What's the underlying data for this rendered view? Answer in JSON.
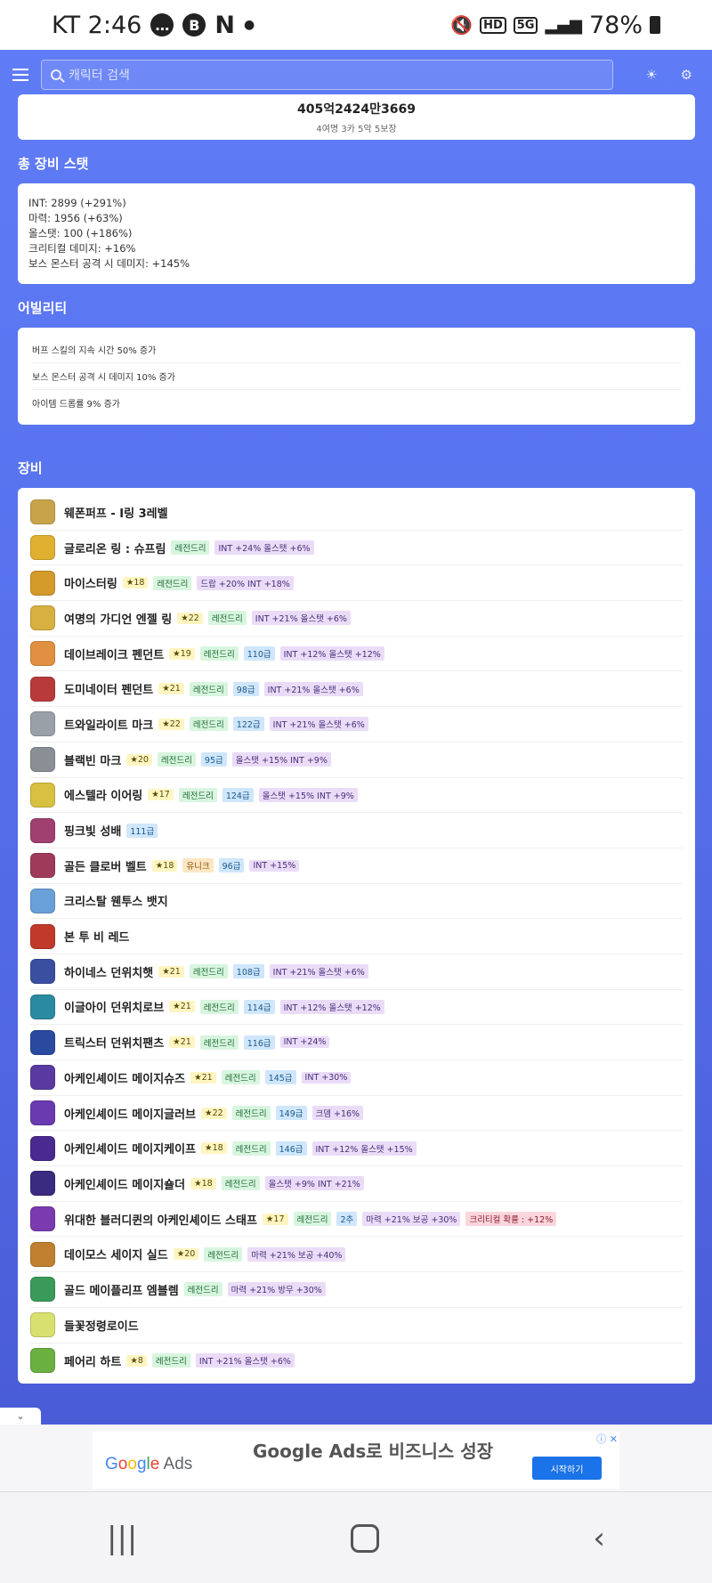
{
  "status_bar": {
    "carrier_time": "KT 2:46",
    "battery": "78%",
    "hd_label": "HD",
    "network_label": "5G"
  },
  "topbar": {
    "search_placeholder": "캐릭터 검색"
  },
  "combat": {
    "value": "405억2424만3669",
    "detail": "4여명 3카 5악 5보장"
  },
  "stats": {
    "title": "총 장비 스탯",
    "lines": [
      "INT: 2899 (+291%)",
      "마력: 1956 (+63%)",
      "올스탯: 100 (+186%)",
      "크리티컬 데미지: +16%",
      "보스 몬스터 공격 시 데미지: +145%"
    ]
  },
  "abilities": {
    "title": "어빌리티",
    "items": [
      "버프 스킬의 지속 시간 50% 증가",
      "보스 몬스터 공격 시 데미지 10% 증가",
      "아이템 드롭률 9% 증가"
    ]
  },
  "equipment": {
    "title": "장비",
    "items": [
      {
        "name": "웨폰퍼프 - I링 3레벨",
        "icon": "ring-icon",
        "color": "#c9a34a",
        "tags": []
      },
      {
        "name": "글로리온 링 : 슈프림",
        "icon": "ring-icon",
        "color": "#e0b030",
        "tags": [
          {
            "t": "leg",
            "v": "레전드리"
          },
          {
            "t": "pot",
            "v": "INT +24% 올스탯 +6%"
          }
        ]
      },
      {
        "name": "마이스터링",
        "icon": "ring-icon",
        "color": "#d49a2a",
        "tags": [
          {
            "t": "star",
            "v": "★18"
          },
          {
            "t": "leg",
            "v": "레전드리"
          },
          {
            "t": "pot",
            "v": "드랍 +20% INT +18%"
          }
        ]
      },
      {
        "name": "여명의 가디언 엔젤 링",
        "icon": "ring-icon",
        "color": "#d8b040",
        "tags": [
          {
            "t": "star",
            "v": "★22"
          },
          {
            "t": "leg",
            "v": "레전드리"
          },
          {
            "t": "pot",
            "v": "INT +21% 올스탯 +6%"
          }
        ]
      },
      {
        "name": "데이브레이크 펜던트",
        "icon": "pendant-icon",
        "color": "#e09040",
        "tags": [
          {
            "t": "star",
            "v": "★19"
          },
          {
            "t": "leg",
            "v": "레전드리"
          },
          {
            "t": "grade",
            "v": "110급"
          },
          {
            "t": "pot",
            "v": "INT +12% 올스탯 +12%"
          }
        ]
      },
      {
        "name": "도미네이터 펜던트",
        "icon": "pendant-icon",
        "color": "#b83a3a",
        "tags": [
          {
            "t": "star",
            "v": "★21"
          },
          {
            "t": "leg",
            "v": "레전드리"
          },
          {
            "t": "grade",
            "v": "98급"
          },
          {
            "t": "pot",
            "v": "INT +21% 올스탯 +6%"
          }
        ]
      },
      {
        "name": "트와일라이트 마크",
        "icon": "mark-icon",
        "color": "#9aa0a8",
        "tags": [
          {
            "t": "star",
            "v": "★22"
          },
          {
            "t": "leg",
            "v": "레전드리"
          },
          {
            "t": "grade",
            "v": "122급"
          },
          {
            "t": "pot",
            "v": "INT +21% 올스탯 +6%"
          }
        ]
      },
      {
        "name": "블랙빈 마크",
        "icon": "mark-icon",
        "color": "#8a8f96",
        "tags": [
          {
            "t": "star",
            "v": "★20"
          },
          {
            "t": "leg",
            "v": "레전드리"
          },
          {
            "t": "grade",
            "v": "95급"
          },
          {
            "t": "pot",
            "v": "올스탯 +15% INT +9%"
          }
        ]
      },
      {
        "name": "에스텔라 이어링",
        "icon": "earring-icon",
        "color": "#d8c040",
        "tags": [
          {
            "t": "star",
            "v": "★17"
          },
          {
            "t": "leg",
            "v": "레전드리"
          },
          {
            "t": "grade",
            "v": "124급"
          },
          {
            "t": "pot",
            "v": "올스탯 +15% INT +9%"
          }
        ]
      },
      {
        "name": "핑크빛 성배",
        "icon": "chalice-icon",
        "color": "#a04070",
        "tags": [
          {
            "t": "grade",
            "v": "111급"
          }
        ]
      },
      {
        "name": "골든 클로버 벨트",
        "icon": "belt-icon",
        "color": "#a03a5a",
        "tags": [
          {
            "t": "star",
            "v": "★18"
          },
          {
            "t": "uni",
            "v": "유니크"
          },
          {
            "t": "grade",
            "v": "96급"
          },
          {
            "t": "pot",
            "v": "INT +15%"
          }
        ]
      },
      {
        "name": "크리스탈 웬투스 뱃지",
        "icon": "badge-icon",
        "color": "#6aa0d8",
        "tags": []
      },
      {
        "name": "본 투 비 레드",
        "icon": "medal-icon",
        "color": "#c0392b",
        "tags": []
      },
      {
        "name": "하이네스 던위치햇",
        "icon": "hat-icon",
        "color": "#3a4fa0",
        "tags": [
          {
            "t": "star",
            "v": "★21"
          },
          {
            "t": "leg",
            "v": "레전드리"
          },
          {
            "t": "grade",
            "v": "108급"
          },
          {
            "t": "pot",
            "v": "INT +21% 올스탯 +6%"
          }
        ]
      },
      {
        "name": "이글아이 던위치로브",
        "icon": "robe-icon",
        "color": "#2a8aa0",
        "tags": [
          {
            "t": "star",
            "v": "★21"
          },
          {
            "t": "leg",
            "v": "레전드리"
          },
          {
            "t": "grade",
            "v": "114급"
          },
          {
            "t": "pot",
            "v": "INT +12% 올스탯 +12%"
          }
        ]
      },
      {
        "name": "트릭스터 던위치팬츠",
        "icon": "pants-icon",
        "color": "#2a4aa0",
        "tags": [
          {
            "t": "star",
            "v": "★21"
          },
          {
            "t": "leg",
            "v": "레전드리"
          },
          {
            "t": "grade",
            "v": "116급"
          },
          {
            "t": "pot",
            "v": "INT +24%"
          }
        ]
      },
      {
        "name": "아케인셰이드 메이지슈즈",
        "icon": "shoes-icon",
        "color": "#5a3aa0",
        "tags": [
          {
            "t": "star",
            "v": "★21"
          },
          {
            "t": "leg",
            "v": "레전드리"
          },
          {
            "t": "grade",
            "v": "145급"
          },
          {
            "t": "pot",
            "v": "INT +30%"
          }
        ]
      },
      {
        "name": "아케인셰이드 메이지글러브",
        "icon": "glove-icon",
        "color": "#6a3ab0",
        "tags": [
          {
            "t": "star",
            "v": "★22"
          },
          {
            "t": "leg",
            "v": "레전드리"
          },
          {
            "t": "grade",
            "v": "149급"
          },
          {
            "t": "pot",
            "v": "크뎀 +16%"
          }
        ]
      },
      {
        "name": "아케인셰이드 메이지케이프",
        "icon": "cape-icon",
        "color": "#4a2a90",
        "tags": [
          {
            "t": "star",
            "v": "★18"
          },
          {
            "t": "leg",
            "v": "레전드리"
          },
          {
            "t": "grade",
            "v": "146급"
          },
          {
            "t": "pot",
            "v": "INT +12% 올스탯 +15%"
          }
        ]
      },
      {
        "name": "아케인셰이드 메이지숄더",
        "icon": "shoulder-icon",
        "color": "#3a2a80",
        "tags": [
          {
            "t": "star",
            "v": "★18"
          },
          {
            "t": "leg",
            "v": "레전드리"
          },
          {
            "t": "pot",
            "v": "올스탯 +9% INT +21%"
          }
        ]
      },
      {
        "name": "위대한 블러디퀸의 아케인셰이드 스태프",
        "icon": "staff-icon",
        "color": "#7a3ab0",
        "tags": [
          {
            "t": "star",
            "v": "★17"
          },
          {
            "t": "leg",
            "v": "레전드리"
          },
          {
            "t": "grade",
            "v": "2추"
          },
          {
            "t": "pot",
            "v": "마력 +21% 보공 +30%"
          },
          {
            "t": "crit",
            "v": "크리티컬 확률 : +12%"
          }
        ]
      },
      {
        "name": "데이모스 세이지 실드",
        "icon": "shield-icon",
        "color": "#c08030",
        "tags": [
          {
            "t": "star",
            "v": "★20"
          },
          {
            "t": "leg",
            "v": "레전드리"
          },
          {
            "t": "pot",
            "v": "마력 +21% 보공 +40%"
          }
        ]
      },
      {
        "name": "골드 메이플리프 엠블렘",
        "icon": "emblem-icon",
        "color": "#3a9a5a",
        "tags": [
          {
            "t": "leg",
            "v": "레전드리"
          },
          {
            "t": "pot",
            "v": "마력 +21% 방무 +30%"
          }
        ]
      },
      {
        "name": "들꽃정령로이드",
        "icon": "android-icon",
        "color": "#d8e070",
        "tags": []
      },
      {
        "name": "페어리 하트",
        "icon": "heart-icon",
        "color": "#6ab040",
        "tags": [
          {
            "t": "star",
            "v": "★8"
          },
          {
            "t": "leg",
            "v": "레전드리"
          },
          {
            "t": "pot",
            "v": "INT +21% 올스탯 +6%"
          }
        ]
      }
    ]
  },
  "ad": {
    "logo": "Google Ads",
    "headline": "Google Ads로 비즈니스 성장",
    "cta": "시작하기"
  }
}
